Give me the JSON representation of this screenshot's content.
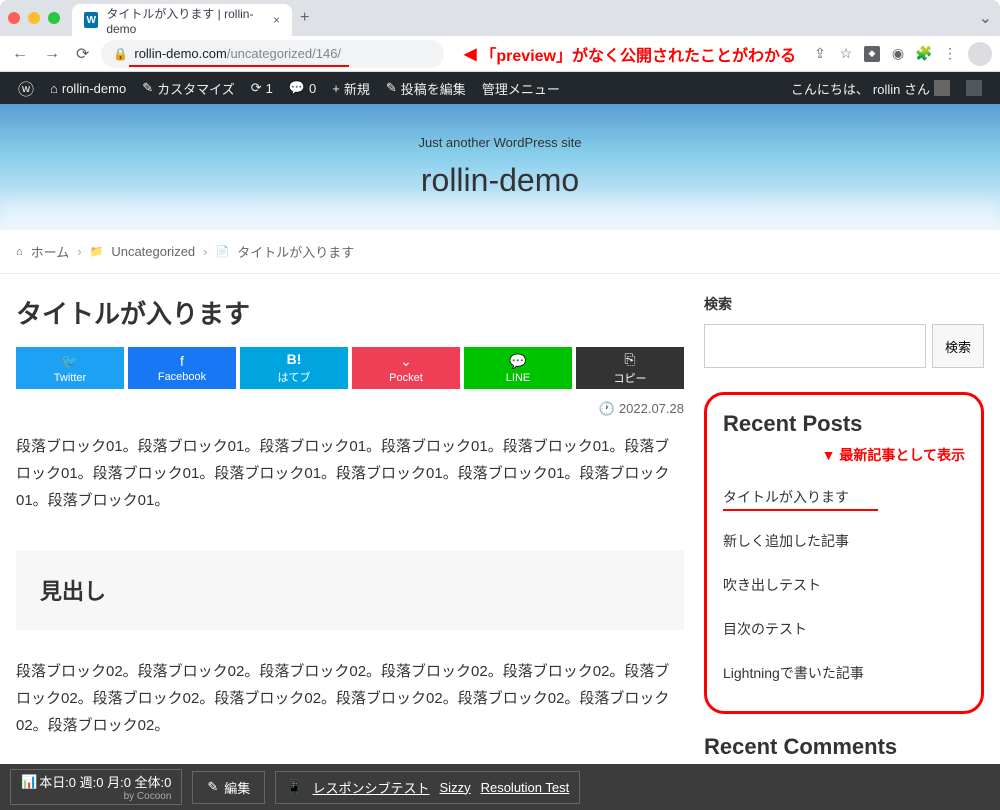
{
  "browser": {
    "tab_title": "タイトルが入ります | rollin-demo",
    "url_domain": "rollin-demo.com",
    "url_path": "/uncategorized/146/",
    "annotation": "「preview」がなく公開されたことがわかる"
  },
  "wp_bar": {
    "site_name": "rollin-demo",
    "customize": "カスタマイズ",
    "updates_count": "1",
    "comments_count": "0",
    "new": "新規",
    "edit_post": "投稿を編集",
    "admin_menu": "管理メニュー",
    "greeting_prefix": "こんにちは、",
    "greeting_user": "rollin さん"
  },
  "header": {
    "tagline": "Just another WordPress site",
    "title": "rollin-demo"
  },
  "breadcrumb": {
    "home": "ホーム",
    "category": "Uncategorized",
    "current": "タイトルが入ります"
  },
  "post": {
    "title": "タイトルが入ります",
    "date": "2022.07.28",
    "paragraph1": "段落ブロック01。段落ブロック01。段落ブロック01。段落ブロック01。段落ブロック01。段落ブロック01。段落ブロック01。段落ブロック01。段落ブロック01。段落ブロック01。段落ブロック01。段落ブロック01。",
    "heading": "見出し",
    "paragraph2": "段落ブロック02。段落ブロック02。段落ブロック02。段落ブロック02。段落ブロック02。段落ブロック02。段落ブロック02。段落ブロック02。段落ブロック02。段落ブロック02。段落ブロック02。段落ブロック02。"
  },
  "share": {
    "twitter": "Twitter",
    "facebook": "Facebook",
    "hatena": "はてブ",
    "pocket": "Pocket",
    "line": "LINE",
    "copy": "コピー"
  },
  "sidebar": {
    "search_label": "検索",
    "search_button": "検索",
    "recent_title": "Recent Posts",
    "recent_note": "▼ 最新記事として表示",
    "recent_posts": [
      "タイトルが入ります",
      "新しく追加した記事",
      "吹き出しテスト",
      "目次のテスト",
      "Lightningで書いた記事"
    ],
    "recent_comments_title": "Recent Comments"
  },
  "bottom": {
    "stats": "本日:0 週:0 月:0 全体:0",
    "stats_by": "by Cocoon",
    "edit": "編集",
    "responsive": "レスポンシブテスト",
    "sizzy": "Sizzy",
    "resolution": "Resolution Test"
  }
}
